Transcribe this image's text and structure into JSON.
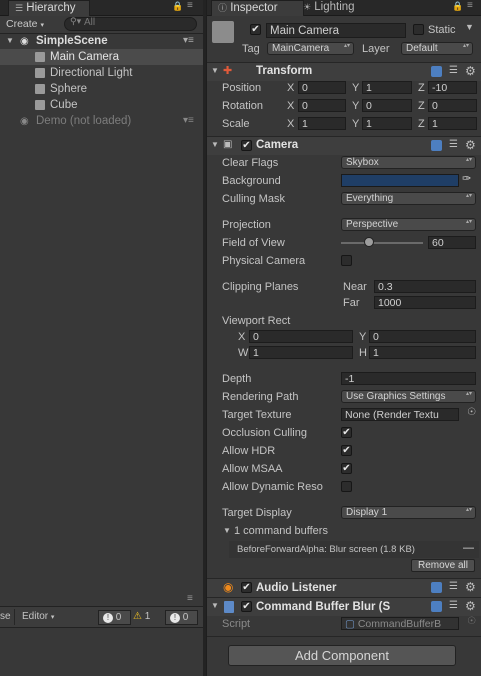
{
  "hierarchy": {
    "tab_label": "Hierarchy",
    "create_label": "Create",
    "search_placeholder": "All",
    "scene_name": "SimpleScene",
    "items": [
      "Main Camera",
      "Directional Light",
      "Sphere",
      "Cube"
    ],
    "unloaded_scene": "Demo (not loaded)"
  },
  "console": {
    "editor_label": "Editor",
    "left_cut": "se",
    "info_count": "0",
    "warn_count": "1",
    "error_count": "0"
  },
  "inspector": {
    "tab_label": "Inspector",
    "lighting_tab_label": "Lighting",
    "object_name": "Main Camera",
    "static_label": "Static",
    "tag_label": "Tag",
    "tag_value": "MainCamera",
    "layer_label": "Layer",
    "layer_value": "Default",
    "transform": {
      "title": "Transform",
      "position_label": "Position",
      "rotation_label": "Rotation",
      "scale_label": "Scale",
      "x": "X",
      "y": "Y",
      "z": "Z",
      "position": [
        "0",
        "1",
        "-10"
      ],
      "rotation": [
        "0",
        "0",
        "0"
      ],
      "scale": [
        "1",
        "1",
        "1"
      ]
    },
    "camera": {
      "title": "Camera",
      "clear_flags_label": "Clear Flags",
      "clear_flags": "Skybox",
      "background_label": "Background",
      "background_color": "#1f3e66",
      "culling_mask_label": "Culling Mask",
      "culling_mask": "Everything",
      "projection_label": "Projection",
      "projection": "Perspective",
      "fov_label": "Field of View",
      "fov": "60",
      "physical_camera_label": "Physical Camera",
      "clipping_planes_label": "Clipping Planes",
      "near_label": "Near",
      "near": "0.3",
      "far_label": "Far",
      "far": "1000",
      "viewport_label": "Viewport Rect",
      "vp_x_label": "X",
      "vp_x": "0",
      "vp_y_label": "Y",
      "vp_y": "0",
      "vp_w_label": "W",
      "vp_w": "1",
      "vp_h_label": "H",
      "vp_h": "1",
      "depth_label": "Depth",
      "depth": "-1",
      "rendering_path_label": "Rendering Path",
      "rendering_path": "Use Graphics Settings",
      "target_texture_label": "Target Texture",
      "target_texture": "None (Render Textu",
      "occlusion_label": "Occlusion Culling",
      "hdr_label": "Allow HDR",
      "msaa_label": "Allow MSAA",
      "dynres_label": "Allow Dynamic Reso",
      "target_display_label": "Target Display",
      "target_display": "Display 1",
      "command_buffers": "1 command buffers",
      "buffer_entry": "BeforeForwardAlpha: Blur screen (1.8 KB)",
      "remove_all": "Remove all"
    },
    "audio_listener": {
      "title": "Audio Listener"
    },
    "cmd_blur": {
      "title": "Command Buffer Blur (S",
      "script_label": "Script",
      "script_value": "CommandBufferB"
    },
    "add_component": "Add Component"
  }
}
